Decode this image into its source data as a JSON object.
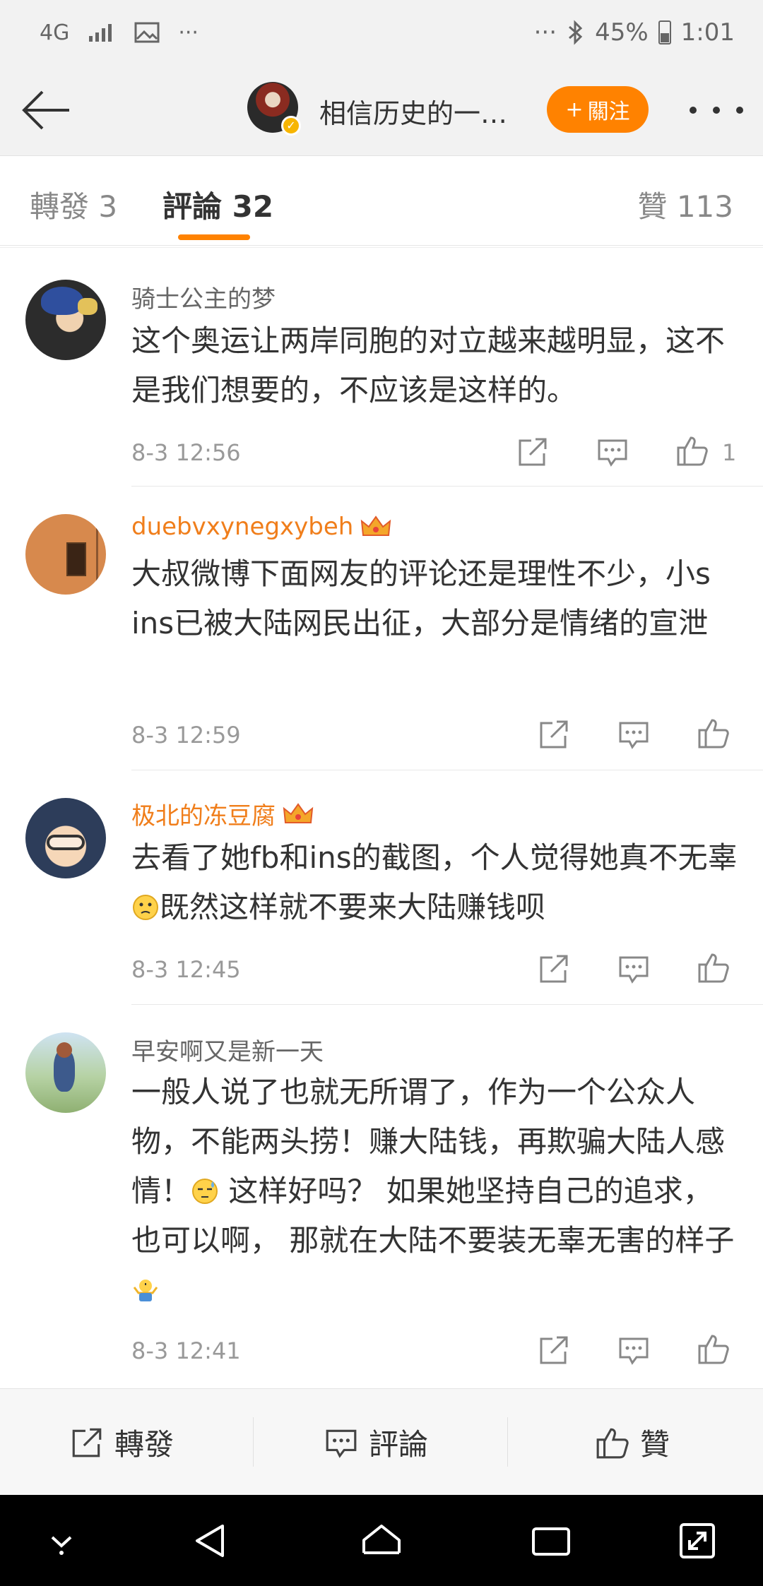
{
  "status_bar": {
    "network": "4G",
    "right_dots": "···",
    "left_dots": "···",
    "battery": "45%",
    "time": "1:01"
  },
  "nav": {
    "title": "相信历史的一…",
    "follow_label": "關注",
    "follow_plus": "+"
  },
  "tabs": {
    "repost": "轉發 3",
    "comments": "評論 32",
    "likes": "贊 113"
  },
  "comments": [
    {
      "user": "骑士公主的梦",
      "vip": false,
      "text": "这个奥运让两岸同胞的对立越来越明显，这不是我们想要的，不应该是这样的。",
      "time": "8-3 12:56",
      "likes": "1"
    },
    {
      "user": "duebvxynegxybeh",
      "vip": true,
      "text": "大叔微博下面网友的评论还是理性不少，小s ins已被大陆网民出征，大部分是情绪的宣泄",
      "time": "8-3 12:59",
      "likes": ""
    },
    {
      "user": "极北的冻豆腐",
      "vip": true,
      "text_before": "去看了她fb和ins的截图，个人觉得她真不无辜",
      "text_after": "既然这样就不要来大陆赚钱呗",
      "time": "8-3 12:45",
      "likes": ""
    },
    {
      "user": "早安啊又是新一天",
      "vip": false,
      "text_before": "一般人说了也就无所谓了，作为一个公众人物，不能两头捞！赚大陆钱，再欺骗大陆人感情！",
      "text_middle": "  这样好吗？ 如果她坚持自己的追求，也可以啊， 那就在大陆不要装无辜无害的样子",
      "time": "8-3 12:41",
      "likes": ""
    }
  ],
  "bottom_bar": {
    "repost": "轉發",
    "comment": "評論",
    "like": "贊"
  },
  "colors": {
    "accent": "#ff8200",
    "vip_name": "#f07e1b"
  }
}
